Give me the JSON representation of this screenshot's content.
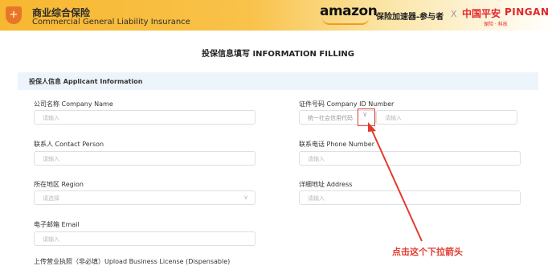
{
  "header": {
    "title_cn": "商业综合保险",
    "title_en": "Commercial General Liability Insurance",
    "shield_icon": "shield-plus-icon",
    "amazon_logo": "amazon",
    "tag": "保险加速器-参与者",
    "separator": "X",
    "pingan_cn": "中国平安",
    "pingan_en": "PINGAN",
    "pingan_slogan": "保险 · 科技",
    "colors": {
      "bar": "#f7b731",
      "pingan": "#e3262b",
      "amazon_smile": "#f29a1f"
    }
  },
  "page_title": "投保信息填写 INFORMATION FILLING",
  "section": {
    "title": "投保人信息 Applicant Information"
  },
  "fields": {
    "company_name": {
      "label": "公司名称 Company Name",
      "placeholder": "请输入"
    },
    "id_number": {
      "label": "证件号码 Company ID Number",
      "type_value": "统一社会信用代码",
      "placeholder": "请输入"
    },
    "contact": {
      "label": "联系人 Contact Person",
      "placeholder": "请输入"
    },
    "phone": {
      "label": "联系电话 Phone Number",
      "placeholder": "请输入"
    },
    "region": {
      "label": "所在地区 Region",
      "placeholder": "请选择"
    },
    "address": {
      "label": "详细地址 Address",
      "placeholder": "请输入"
    },
    "email": {
      "label": "电子邮箱 Email",
      "placeholder": "请输入"
    },
    "license": {
      "label": "上传营业执照（非必填）Upload Business License (Dispensable)"
    }
  },
  "annotation": {
    "text": "点击这个下拉箭头",
    "color": "#e23b2e"
  }
}
